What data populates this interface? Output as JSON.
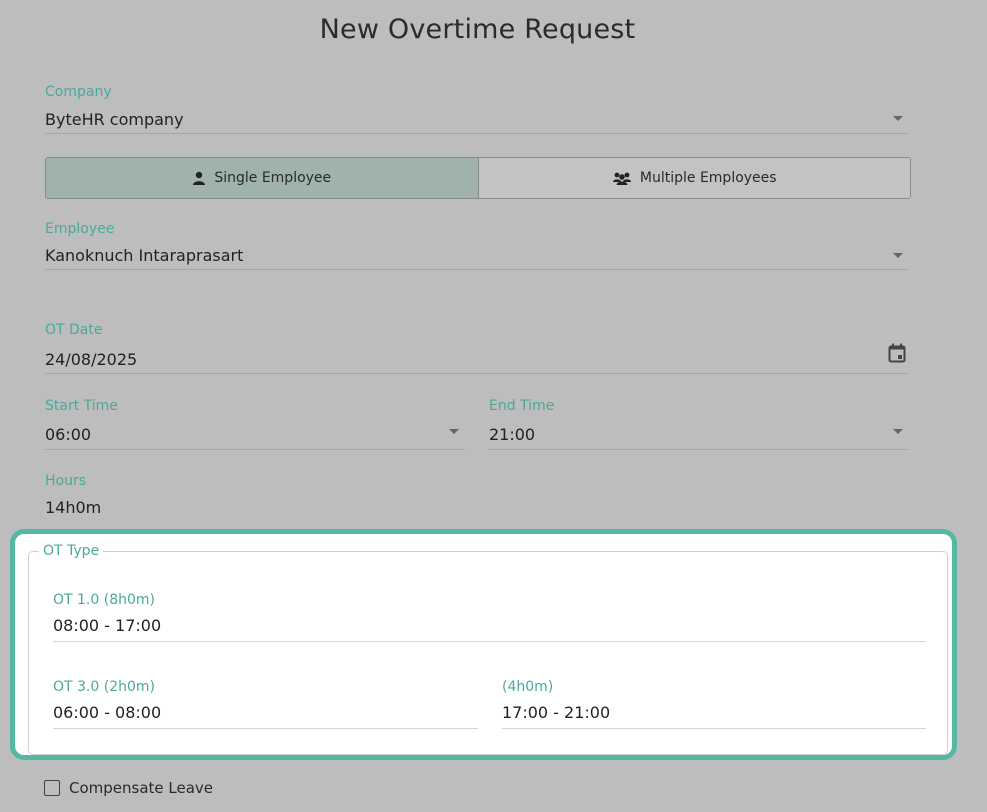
{
  "page": {
    "title": "New Overtime Request"
  },
  "company": {
    "label": "Company",
    "value": "ByteHR company"
  },
  "mode_toggle": {
    "single_label": "Single Employee",
    "multiple_label": "Multiple Employees",
    "selected": "single"
  },
  "employee": {
    "label": "Employee",
    "value": "Kanoknuch Intaraprasart"
  },
  "ot_date": {
    "label": "OT Date",
    "value": "24/08/2025",
    "icon": "calendar-icon"
  },
  "start_time": {
    "label": "Start Time",
    "value": "06:00"
  },
  "end_time": {
    "label": "End Time",
    "value": "21:00"
  },
  "hours": {
    "label": "Hours",
    "value": "14h0m"
  },
  "ot_type": {
    "legend": "OT Type",
    "ot1": {
      "label": "OT 1.0 (8h0m)",
      "value": "08:00 - 17:00"
    },
    "ot3_a": {
      "label": "OT 3.0 (2h0m)",
      "value": "06:00 - 08:00"
    },
    "ot3_b": {
      "label": "(4h0m)",
      "value": "17:00 - 21:00"
    }
  },
  "compensate": {
    "label": "Compensate Leave",
    "checked": false
  },
  "colors": {
    "accent": "#4aa99a",
    "highlight_border": "#54b8a3",
    "background": "#bdbdbd"
  }
}
